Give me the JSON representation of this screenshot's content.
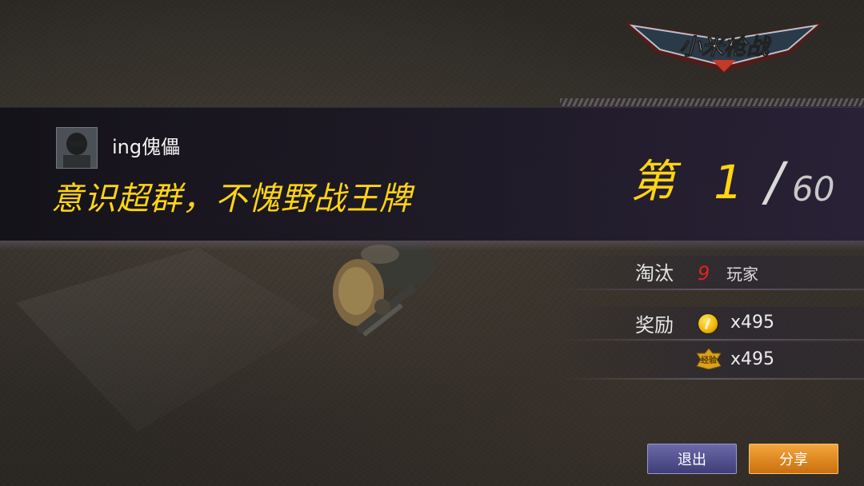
{
  "game": {
    "logo_text": "小米枪战"
  },
  "player": {
    "name": "ing傀儡",
    "slogan": "意识超群，不愧野战王牌"
  },
  "rank": {
    "prefix": "第",
    "value": "1",
    "slash": "/",
    "total": "60"
  },
  "stats": {
    "eliminated_label": "淘汰",
    "eliminated_count": "9",
    "eliminated_unit": "玩家",
    "reward_label": "奖励",
    "rewards": [
      {
        "icon": "gold-coin-icon",
        "value": "x495"
      },
      {
        "icon": "experience-badge-icon",
        "value": "x495",
        "badge_text": "经验"
      }
    ]
  },
  "buttons": {
    "exit_label": "退出",
    "share_label": "分享"
  },
  "colors": {
    "highlight_yellow": "#ffd414",
    "elimination_red": "#e12222",
    "exit_button": "#4b4a8a",
    "share_button": "#e08a20"
  }
}
